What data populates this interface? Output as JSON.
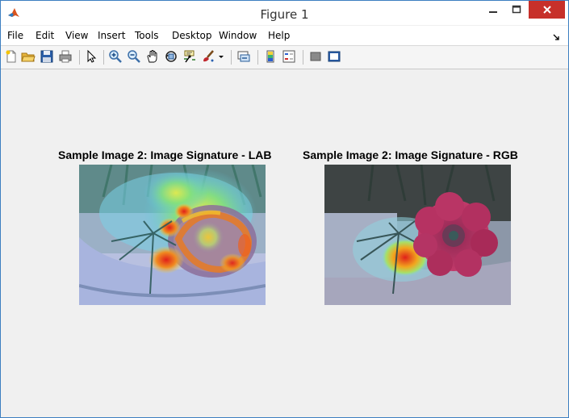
{
  "window": {
    "title": "Figure 1"
  },
  "menu": {
    "items": [
      "File",
      "Edit",
      "View",
      "Insert",
      "Tools",
      "Desktop",
      "Window",
      "Help"
    ]
  },
  "toolbar": {
    "tools": [
      "new-figure",
      "open-file",
      "save",
      "print",
      "edit-plot",
      "zoom-in",
      "zoom-out",
      "pan",
      "rotate-3d",
      "data-cursor",
      "brush",
      "link-plot",
      "insert-colorbar",
      "insert-legend",
      "hide-plot-tools",
      "show-plot-tools"
    ]
  },
  "axes": [
    {
      "title": "Sample Image 2: Image Signature - LAB"
    },
    {
      "title": "Sample Image 2: Image Signature - RGB"
    }
  ],
  "colors": {
    "close": "#c7302a",
    "heat_hot": "#e0201a",
    "flower": "#b0305c"
  }
}
